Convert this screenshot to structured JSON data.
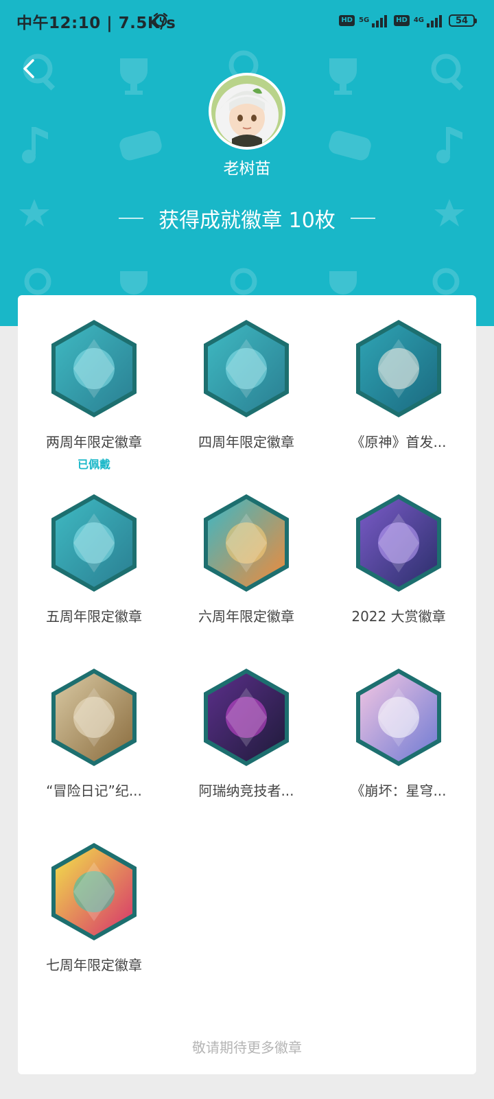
{
  "status_bar": {
    "time": "中午12:10 | 7.5K/s",
    "hd1": "HD",
    "net1": "5G",
    "hd2": "HD",
    "net2": "4G",
    "battery": "54"
  },
  "profile": {
    "name": "老树苗",
    "summary": "获得成就徽章 10枚"
  },
  "badges": [
    {
      "name": "两周年限定徽章",
      "status": "已佩戴",
      "theme": "teal"
    },
    {
      "name": "四周年限定徽章",
      "status": "",
      "theme": "teal"
    },
    {
      "name": "《原神》首发...",
      "status": "",
      "theme": "anime"
    },
    {
      "name": "五周年限定徽章",
      "status": "",
      "theme": "teal"
    },
    {
      "name": "六周年限定徽章",
      "status": "",
      "theme": "orange"
    },
    {
      "name": "2022 大赏徽章",
      "status": "",
      "theme": "purple"
    },
    {
      "name": "“冒险日记”纪...",
      "status": "",
      "theme": "sepia"
    },
    {
      "name": "阿瑞纳竞技者...",
      "status": "",
      "theme": "violet"
    },
    {
      "name": "《崩坏：星穹...",
      "status": "",
      "theme": "pink"
    },
    {
      "name": "七周年限定徽章",
      "status": "",
      "theme": "colorful"
    }
  ],
  "footer": {
    "text": "敬请期待更多徽章"
  },
  "colors": {
    "primary": "#19b7c8",
    "badge_frame": "#1d6f6f"
  }
}
